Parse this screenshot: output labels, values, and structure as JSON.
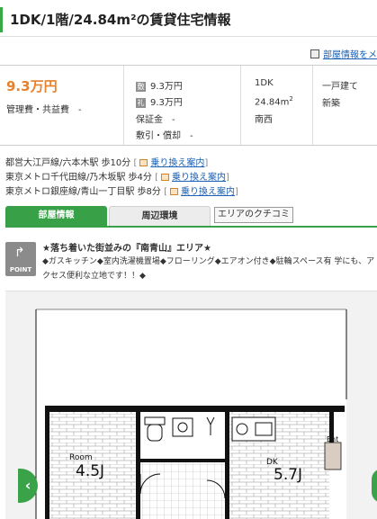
{
  "page": {
    "title": "1DK/1階/24.84m²の賃貸住宅情報",
    "info_link": "部屋情報をメ"
  },
  "summary": {
    "rent": "9.3万円",
    "management_fee": "管理費・共益費　-",
    "deposit_badge": "敷",
    "deposit": "9.3万円",
    "key_money_badge": "礼",
    "key_money": "9.3万円",
    "guarantee": "保証金　-",
    "shikibiki": "敷引・償却　-",
    "layout": "1DK",
    "area_prefix": "24.84m",
    "area_sup": "2",
    "direction": "南西",
    "building_type": "一戸建て",
    "age": "新築"
  },
  "stations": [
    {
      "text": "都営大江戸線/六本木駅 歩10分",
      "link": "乗り換え案内"
    },
    {
      "text": "東京メトロ千代田線/乃木坂駅 歩4分",
      "link": "乗り換え案内"
    },
    {
      "text": "東京メトロ銀座線/青山一丁目駅 歩8分",
      "link": "乗り換え案内"
    }
  ],
  "tabs": {
    "room_info": "部屋情報",
    "surroundings": "周辺環境",
    "area_reviews": "エリアのクチコミ"
  },
  "point": {
    "label": "POINT",
    "catch": "★落ち着いた街並みの『南青山』エリア★",
    "description": "◆ガスキッチン◆室内洗濯機置場◆フローリング◆エアオン付き◆駐輪スペース有 学にも、アクセス便利な立地です！！◆"
  },
  "floorplan": {
    "room_name": "Room",
    "room_size": "4.5J",
    "dk_name": "DK",
    "dk_size": "5.7J",
    "entrance": "Ent"
  },
  "icons": {
    "info": "document-icon",
    "route": "route-icon",
    "point": "arrow-up-icon",
    "prev": "chevron-left-icon",
    "next": "chevron-right-icon"
  },
  "colors": {
    "accent_green": "#38a046",
    "price_orange": "#e8812a",
    "link_blue": "#1a5fb4"
  }
}
